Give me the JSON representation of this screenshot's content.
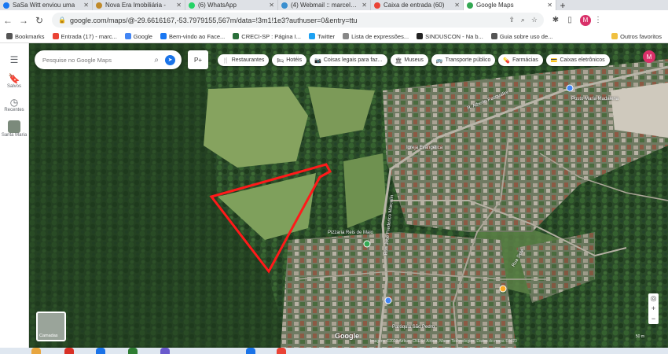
{
  "tabs": [
    {
      "label": "SaSa Witt enviou uma",
      "color": "#1877f2",
      "icon": "facebook-icon"
    },
    {
      "label": "Nova Era Imobiliária -",
      "color": "#c08a2a",
      "icon": "house-icon"
    },
    {
      "label": "(6) WhatsApp",
      "color": "#25d366",
      "icon": "whatsapp-icon"
    },
    {
      "label": "(4) Webmail :: marcelo@",
      "color": "#3a8fcf",
      "icon": "mail-icon"
    },
    {
      "label": "Caixa de entrada (60)",
      "color": "#ea4335",
      "icon": "gmail-icon"
    },
    {
      "label": "Google Maps",
      "color": "#34a853",
      "icon": "maps-pin-icon",
      "active": true
    }
  ],
  "browser": {
    "url": "google.com/maps/@-29.6616167,-53.7979155,567m/data=!3m1!1e3?authuser=0&entry=ttu",
    "profile_initial": "M"
  },
  "bookmarks": [
    {
      "label": "Bookmarks",
      "color": "#555"
    },
    {
      "label": "Entrada (17) - marc...",
      "color": "#ea4335"
    },
    {
      "label": "Google",
      "color": "#4285f4"
    },
    {
      "label": "Bem-vindo ao Face...",
      "color": "#1877f2"
    },
    {
      "label": "CRECI-SP : Página I...",
      "color": "#2a6f3a"
    },
    {
      "label": "Twitter",
      "color": "#1da1f2"
    },
    {
      "label": "Lista de expressões...",
      "color": "#888"
    },
    {
      "label": "SINDUSCON - Na b...",
      "color": "#222"
    },
    {
      "label": "Guia sobre uso de...",
      "color": "#555"
    }
  ],
  "bookmarks_other": "Outros favoritos",
  "sidebar": {
    "saved_label": "Salvos",
    "recent_label": "Recentes",
    "place_label": "Santa Maria"
  },
  "maps": {
    "search_placeholder": "Pesquise no Google Maps",
    "layer_label": "P+",
    "chips": [
      {
        "label": "Restaurantes",
        "icon": "fork-knife-icon"
      },
      {
        "label": "Hotéis",
        "icon": "bed-icon"
      },
      {
        "label": "Coisas legais para faz...",
        "icon": "camera-icon"
      },
      {
        "label": "Museus",
        "icon": "museum-icon"
      },
      {
        "label": "Transporte público",
        "icon": "bus-icon"
      },
      {
        "label": "Farmácias",
        "icon": "pharmacy-icon"
      },
      {
        "label": "Caixas eletrônicos",
        "icon": "atm-icon"
      }
    ],
    "avatar_initial": "M",
    "layers_label": "Camadas",
    "google_logo": "Google",
    "attribution": "Imagens ©2023 Airbus, CNES / Airbus, Maxar Technologies, Dados do mapa ©2023",
    "scale_label": "50 m",
    "street_labels": [
      "R. Alberto Pasqualini",
      "Rua José Frederico Marcolin",
      "Rua Sete"
    ],
    "place_labels": [
      "Igreja Evangélica",
      "Posto Maria Madalena",
      "Paróquia São Pedro",
      "Pizzaria Reis de Maio"
    ]
  },
  "colors": {
    "polygon": "#ff1a1a",
    "forest_dark": "#1f3a1e",
    "forest": "#2f5530",
    "clearing": "#7a9a58",
    "urban": "#8a8a7c"
  }
}
